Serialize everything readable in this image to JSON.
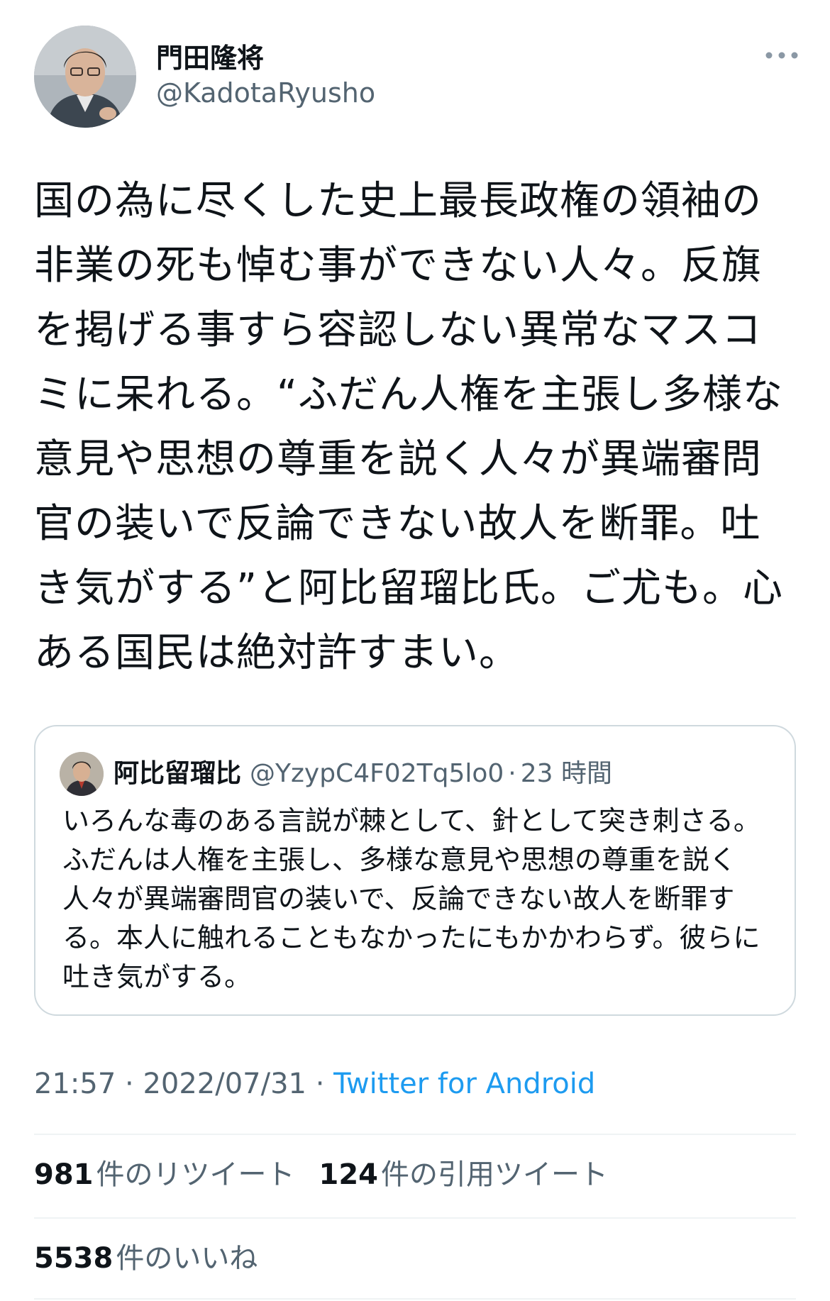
{
  "author": {
    "display_name": "門田隆将",
    "handle": "@KadotaRyusho"
  },
  "more_icon": "more-horizontal-icon",
  "tweet": {
    "text": "国の為に尽くした史上最長政権の領袖の非業の死も悼む事ができない人々。反旗を掲げる事すら容認しない異常なマスコミに呆れる。“ふだん人権を主張し多様な意見や思想の尊重を説く人々が異端審問官の装いで反論できない故人を断罪。吐き気がする”と阿比留瑠比氏。ご尤も。心ある国民は絶対許すまい。"
  },
  "quote": {
    "display_name": "阿比留瑠比",
    "handle": "@YzypC4F02Tq5lo0",
    "separator": "·",
    "time": "23 時間",
    "text": "いろんな毒のある言説が棘として、針として突き刺さる。ふだんは人権を主張し、多様な意見や思想の尊重を説く人々が異端審問官の装いで、反論できない故人を断罪する。本人に触れることもなかったにもかかわらず。彼らに吐き気がする。"
  },
  "meta": {
    "time": "21:57",
    "separator": "·",
    "date": "2022/07/31",
    "source": "Twitter for Android"
  },
  "stats": {
    "retweets": {
      "count": "981",
      "label": "件のリツイート"
    },
    "quotes": {
      "count": "124",
      "label": "件の引用ツイート"
    },
    "likes": {
      "count": "5538",
      "label": "件のいいね"
    }
  },
  "colors": {
    "text": "#0f1419",
    "secondary": "#536471",
    "link": "#1d9bf0",
    "border": "#cfd9de",
    "divider": "#eff3f4"
  }
}
